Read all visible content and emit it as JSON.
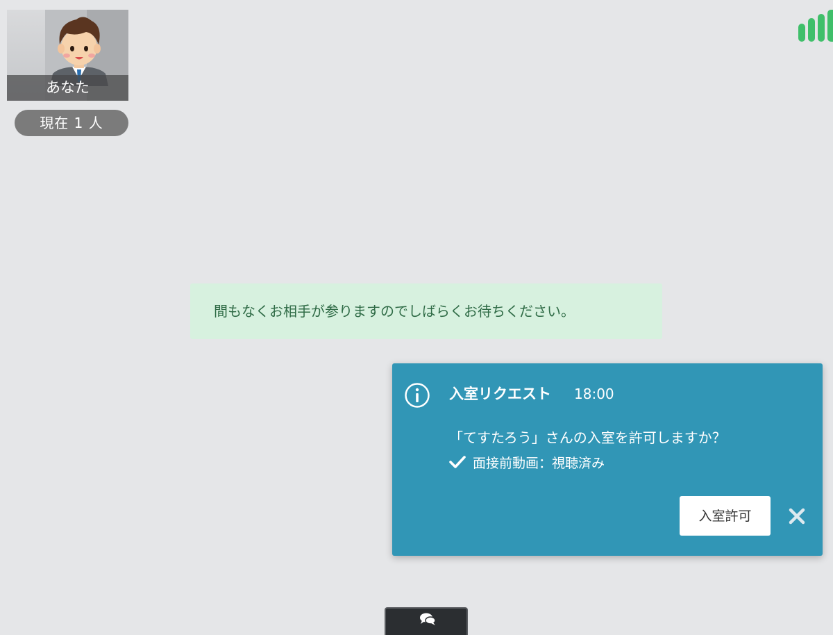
{
  "self_view": {
    "name_label": "あなた",
    "participant_count": "現在 1 人"
  },
  "signal": {
    "icon": "signal-strength-icon",
    "color": "#3fbf6a",
    "bars": 4
  },
  "waiting_message": "間もなくお相手が参りますのでしばらくお待ちください。",
  "notification": {
    "icon": "info-icon",
    "title": "入室リクエスト",
    "time": "18:00",
    "question": "「てすたろう」さんの入室を許可しますか？",
    "status_text": "面接前動画：視聴済み",
    "status_icon": "check-icon",
    "allow_button": "入室許可",
    "close_icon": "close-icon",
    "background_color": "#3196b6"
  },
  "chat_toggle": {
    "icon": "chat-bubbles-icon"
  },
  "colors": {
    "page_background": "#e5e6e8",
    "waiting_background": "#d7f1df",
    "waiting_text": "#2f6b46"
  }
}
